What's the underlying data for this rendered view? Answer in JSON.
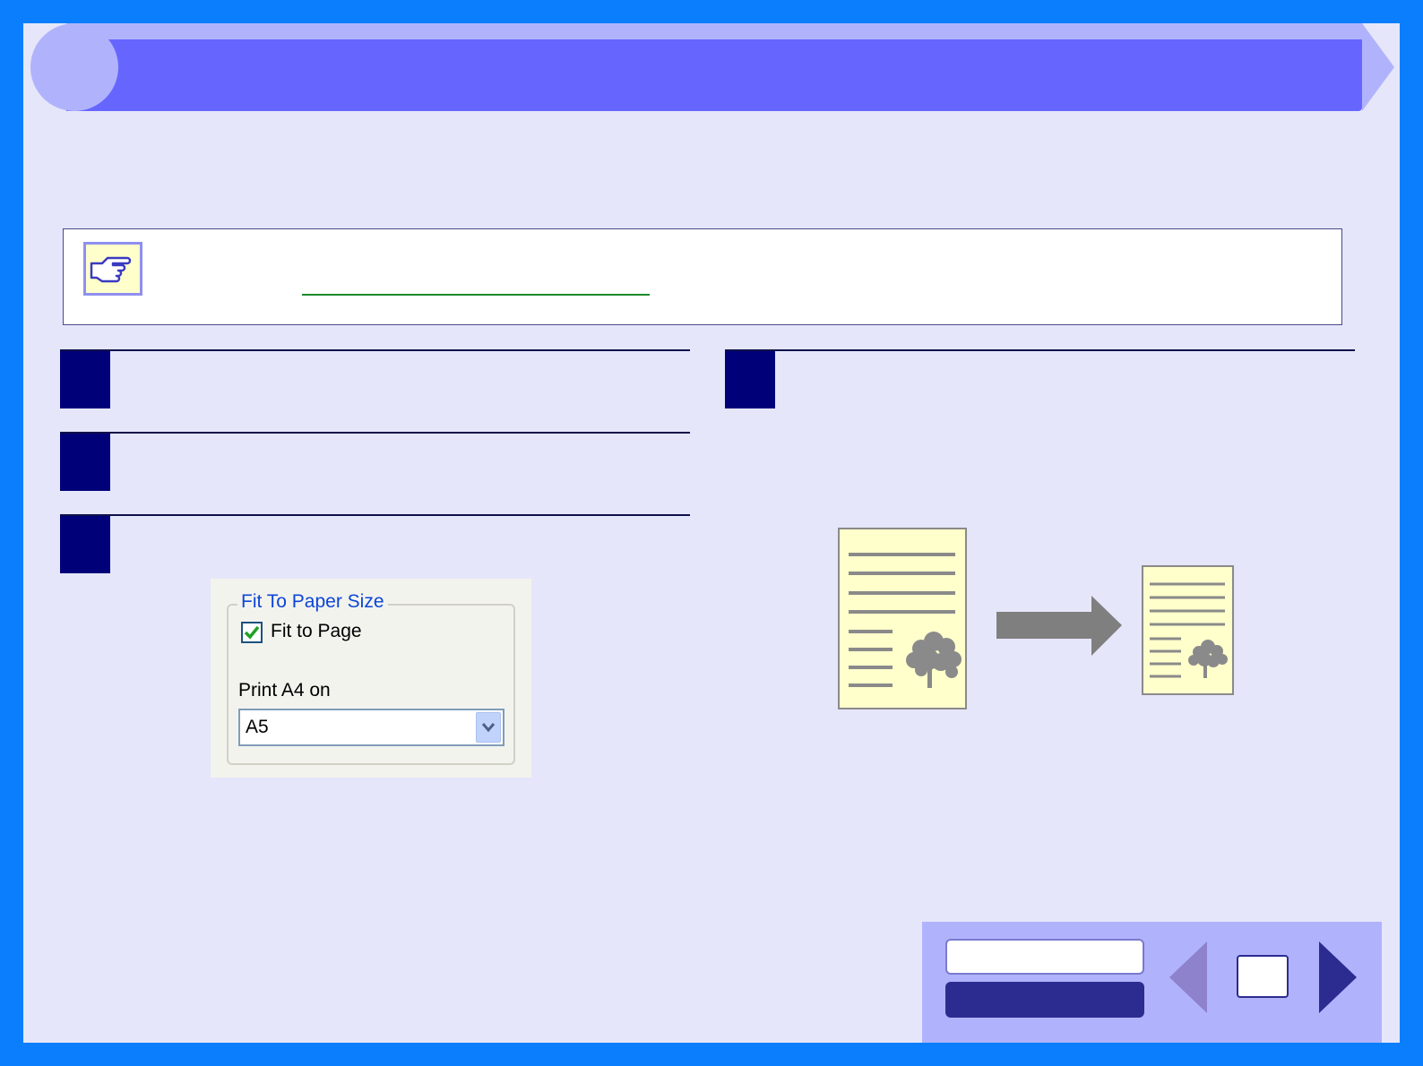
{
  "header": {
    "title": ""
  },
  "note": {
    "icon": "pointing-hand-icon",
    "text": "",
    "link_text": ""
  },
  "steps": [
    {
      "number": "",
      "text": ""
    },
    {
      "number": "",
      "text": ""
    },
    {
      "number": "",
      "text": ""
    },
    {
      "number": "",
      "text": ""
    }
  ],
  "dialog": {
    "group_title": "Fit To Paper Size",
    "checkbox_label": "Fit to Page",
    "checkbox_checked": true,
    "print_label": "Print A4 on",
    "select_value": "A5"
  },
  "illustration": {
    "source_icon": "document-with-tree-icon",
    "arrow_icon": "right-arrow-icon",
    "result_icon": "reduced-document-icon"
  },
  "nav": {
    "top_button_label": "",
    "bottom_button_label": "",
    "page_number": "",
    "prev_icon": "triangle-left-icon",
    "next_icon": "triangle-right-icon"
  },
  "colors": {
    "frame": "#0a7efc",
    "page_background": "#e5e6fa",
    "header_band": "#6666ff",
    "step_block": "#000078",
    "link_underline": "#1b8a2a"
  }
}
